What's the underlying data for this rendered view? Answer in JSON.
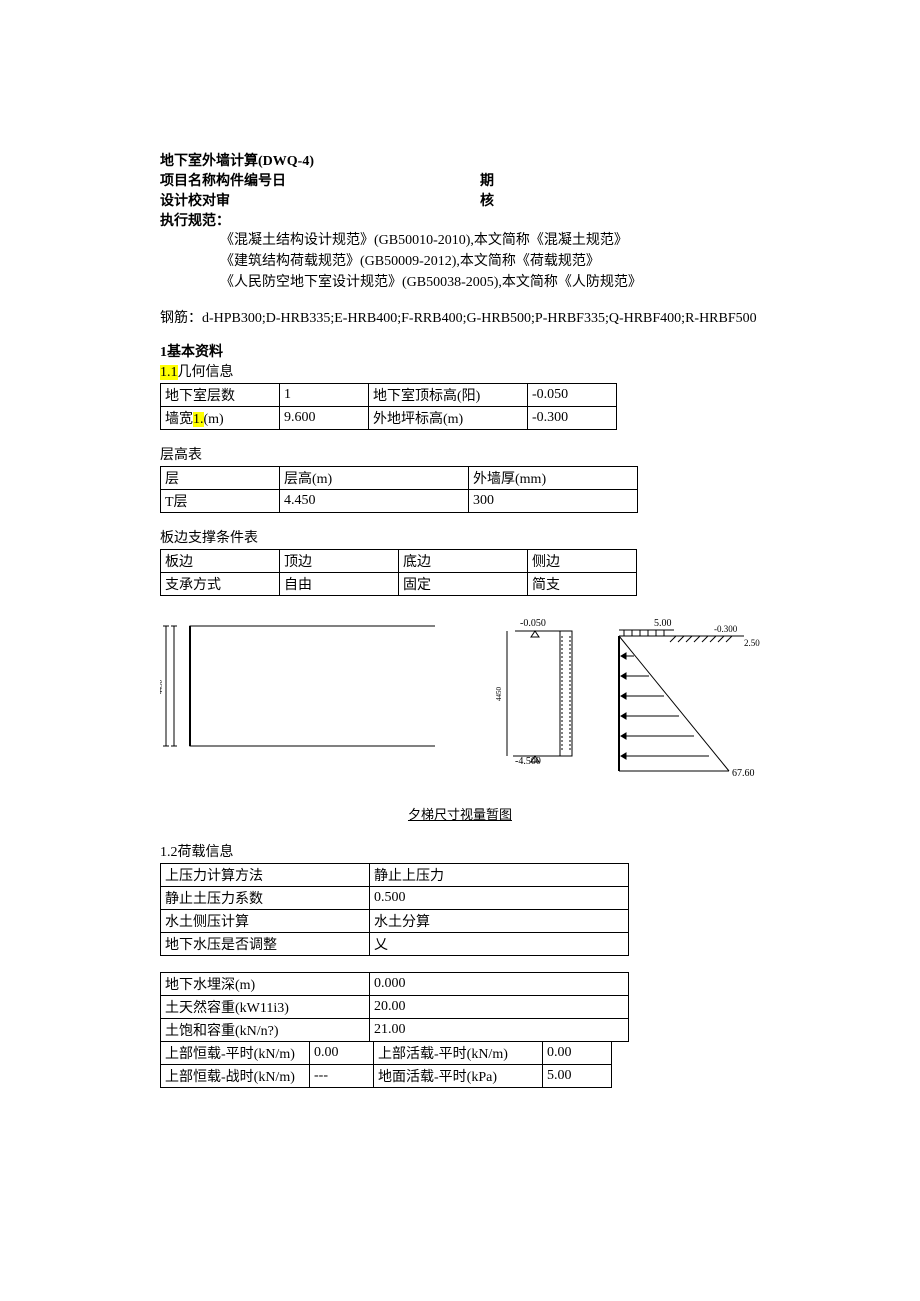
{
  "header": {
    "title": "地下室外墙计算(DWQ-4)",
    "line2_left": "项目名称构件编号日",
    "line2_right": "期",
    "line3_left": "设计校对审",
    "line3_right": "核",
    "exec_label": "执行规范：",
    "specs": [
      "《混凝土结构设计规范》(GB50010-2010),本文简称《混凝土规范》",
      "《建筑结构荷载规范》(GB50009-2012),本文简称《荷载规范》",
      "《人民防空地下室设计规范》(GB50038-2005),本文简称《人防规范》"
    ],
    "rebar": "钢筋：d-HPB300;D-HRB335;E-HRB400;F-RRB400;G-HRB500;P-HRBF335;Q-HRBF400;R-HRBF500"
  },
  "sec1": {
    "title": "1基本资料",
    "sub1_hl": "1.1",
    "sub1_rest": "几何信息",
    "tab1": {
      "r1c1": "地下室层数",
      "r1c2": "1",
      "r1c3": "地下室顶标高(阳)",
      "r1c4": "-0.050",
      "r2c1_a": "墙宽",
      "r2c1_hl": "1.",
      "r2c1_b": "(m)",
      "r2c2": "9.600",
      "r2c3": "外地坪标高(m)",
      "r2c4": "-0.300"
    },
    "tab2_title": "层高表",
    "tab2": {
      "h1": "层",
      "h2": "层高(m)",
      "h3": "外墙厚(mm)",
      "r1c1": "T层",
      "r1c2": "4.450",
      "r1c3": "300"
    },
    "tab3_title": "板边支撑条件表",
    "tab3": {
      "h1": "板边",
      "h2": "顶边",
      "h3": "底边",
      "h4": "侧边",
      "r1c1": "支承方式",
      "r1c2": "自由",
      "r1c3": "固定",
      "r1c4": "简支"
    },
    "diagram": {
      "top_elev": "-0.050",
      "bot_elev": "-4.500",
      "load_top": "5.00",
      "load_right_top": "-0.300",
      "load_right_top2": "2.50",
      "load_bot": "67.60",
      "dim_h": "4450",
      "dim_v": "4450"
    },
    "caption": "夕梯尺寸视量暂图",
    "sub2": "1.2荷载信息",
    "tab4": {
      "r1c1": "上压力计算方法",
      "r1c2": "静止上压力",
      "r2c1": "静止土压力系数",
      "r2c2": "0.500",
      "r3c1": "水土侧压计算",
      "r3c2": "水土分算",
      "r4c1": "地下水压是否调整",
      "r4c2": "乂"
    },
    "tab5": {
      "r1c1": "地下水埋深(m)",
      "r1c2": "0.000",
      "r2c1": "土天然容重(kW11i3)",
      "r2c2": "20.00",
      "r3c1": "土饱和容重(kN/n?)",
      "r3c2": "21.00"
    },
    "tab6": {
      "r1c1": "上部恒载-平时(kN/m)",
      "r1c2": "0.00",
      "r1c3": "上部活载-平时(kN/m)",
      "r1c4": "0.00",
      "r2c1": "上部恒载-战时(kN/m)",
      "r2c2": "---",
      "r2c3": "地面活载-平时(kPa)",
      "r2c4": "5.00"
    }
  }
}
